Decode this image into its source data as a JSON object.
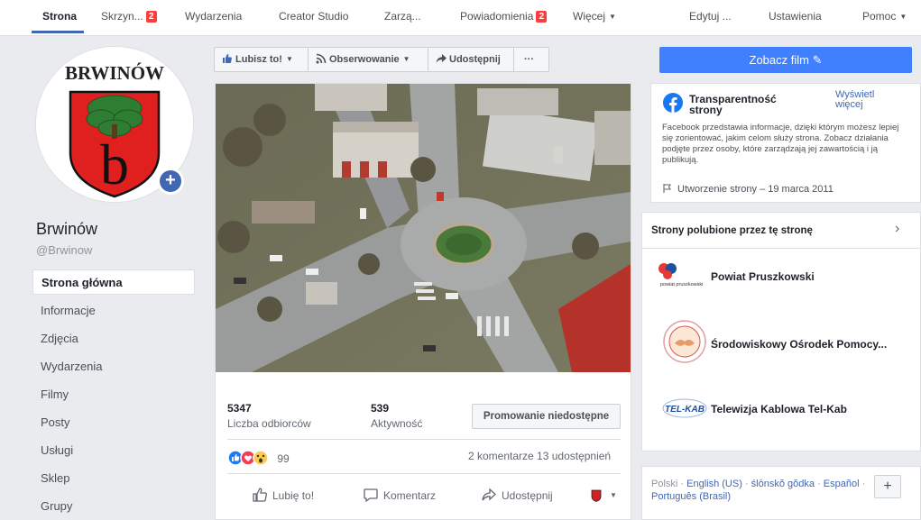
{
  "top_tabs": [
    {
      "label": "Strona",
      "badge": ""
    },
    {
      "label": "Skrzyn...",
      "badge": "2"
    },
    {
      "label": "Wydarzenia",
      "badge": ""
    },
    {
      "label": "Creator Studio",
      "badge": ""
    },
    {
      "label": "Zarzą...",
      "badge": ""
    },
    {
      "label": "Powiadomienia",
      "badge": "2"
    },
    {
      "label": "Więcej",
      "badge": ""
    },
    {
      "label": "Edytuj ...",
      "badge": ""
    },
    {
      "label": "Ustawienia",
      "badge": ""
    },
    {
      "label": "Pomoc",
      "badge": ""
    }
  ],
  "page": {
    "logo_text": "BRWINÓW",
    "logo_letter": "b",
    "name": "Brwinów",
    "handle": "@Brwinow"
  },
  "sidebar": {
    "items": [
      "Strona główna",
      "Informacje",
      "Zdjęcia",
      "Wydarzenia",
      "Filmy",
      "Posty",
      "Usługi",
      "Sklep",
      "Grupy"
    ]
  },
  "action_bar": {
    "like": "Lubisz to!",
    "follow": "Obserwowanie",
    "share": "Udostępnij",
    "more": "···"
  },
  "cta": {
    "label": "Zobacz film"
  },
  "post": {
    "reach_value": "5347",
    "reach_label": "Liczba odbiorców",
    "engagement_value": "539",
    "engagement_label": "Aktywność",
    "promote": "Promowanie niedostępne",
    "reactions_count": "99",
    "comments_shares": "2 komentarze  13 udostępnień",
    "actions": {
      "like": "Lubię to!",
      "comment": "Komentarz",
      "share": "Udostępnij"
    }
  },
  "transparency": {
    "title": "Transparentność strony",
    "see_more": "Wyświetl więcej",
    "description": "Facebook przedstawia informacje, dzięki którym możesz lepiej się zorientować, jakim celom służy strona. Zobacz działania podjęte przez osoby, które zarządzają jej zawartością i ją publikują.",
    "created": "Utworzenie strony – 19 marca 2011"
  },
  "liked_pages": {
    "header": "Strony polubione przez tę stronę",
    "pages": [
      {
        "name": "Powiat Pruszkowski",
        "logo_text": "powiat pruszkowski"
      },
      {
        "name": "Środowiskowy Ośrodek Pomocy...",
        "logo_text": ""
      },
      {
        "name": "Telewizja Kablowa Tel-Kab",
        "logo_text": "TEL-KAB"
      }
    ]
  },
  "languages": {
    "current": "Polski",
    "links": [
      "English (US)",
      "ślōnskŏ gŏdka",
      "Español",
      "Português (Brasil)"
    ]
  },
  "colors": {
    "brand_blue": "#4267b2",
    "cta_blue": "#4080ff",
    "badge_red": "#fa3e3e"
  }
}
